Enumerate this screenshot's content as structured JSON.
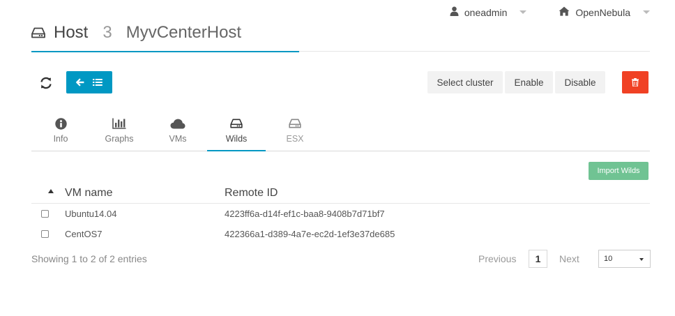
{
  "topbar": {
    "user": "oneadmin",
    "zone": "OpenNebula",
    "user_icon": "user-icon",
    "zone_icon": "home-icon"
  },
  "header": {
    "resource": "Host",
    "id": "3",
    "name": "MyvCenterHost",
    "icon": "hdd-icon"
  },
  "actions": {
    "refresh_icon": "refresh-icon",
    "back_icons": [
      "arrow-left-icon",
      "list-icon"
    ],
    "select_cluster": "Select cluster",
    "enable": "Enable",
    "disable": "Disable",
    "delete_icon": "trash-icon"
  },
  "tabs": [
    {
      "label": "Info",
      "icon": "info-circle-icon"
    },
    {
      "label": "Graphs",
      "icon": "bar-chart-icon"
    },
    {
      "label": "VMs",
      "icon": "cloud-icon"
    },
    {
      "label": "Wilds",
      "icon": "hdd-icon",
      "active": true
    },
    {
      "label": "ESX",
      "icon": "hdd-icon"
    }
  ],
  "import_button": "Import Wilds",
  "table": {
    "columns": [
      "VM name",
      "Remote ID"
    ],
    "rows": [
      {
        "name": "Ubuntu14.04",
        "remote_id": "4223ff6a-d14f-ef1c-baa8-9408b7d71bf7"
      },
      {
        "name": "CentOS7",
        "remote_id": "422366a1-d389-4a7e-ec2d-1ef3e37de685"
      }
    ]
  },
  "footer": {
    "entries_info": "Showing 1 to 2 of 2 entries",
    "previous": "Previous",
    "page": "1",
    "next": "Next",
    "page_length": "10"
  },
  "colors": {
    "accent": "#0098c3",
    "danger": "#f04124",
    "success": "#70c393"
  }
}
